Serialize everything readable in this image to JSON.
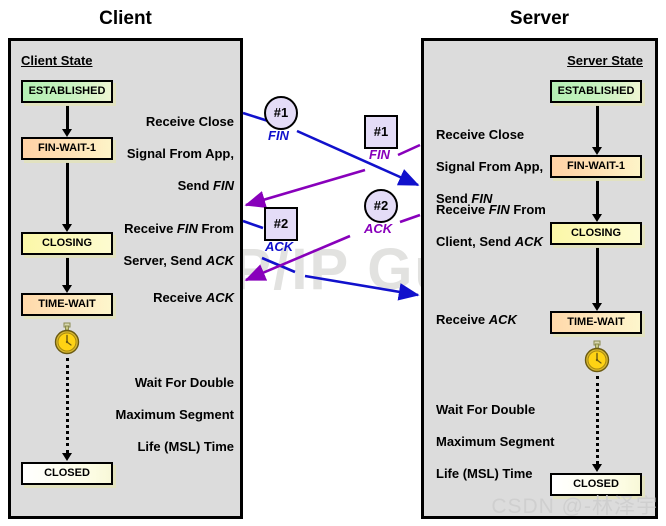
{
  "diagram": {
    "title_client": "Client",
    "title_server": "Server",
    "watermark_guide": "The TCP/IP Guide",
    "watermark_csdn": "CSDN @-林泽宇",
    "colors": {
      "panel_fill": "#dcdcdc",
      "established": "#b4f0b4",
      "fin_wait": "#ffd2a6",
      "closing": "#fbf7a8",
      "time_wait": "#ffd9ab",
      "closed": "#ffffff",
      "blue_arrow": "#1111cc",
      "purple_arrow": "#8800bb",
      "marker_fill": "#e4dcf7"
    }
  },
  "client": {
    "heading": "Client State",
    "states": [
      {
        "label": "ESTABLISHED"
      },
      {
        "label": "FIN-WAIT-1"
      },
      {
        "label": "CLOSING"
      },
      {
        "label": "TIME-WAIT"
      },
      {
        "label": "CLOSED"
      }
    ],
    "actions": [
      {
        "line1": "Receive Close",
        "line2": "Signal From App,",
        "line3_pre": "Send ",
        "line3_em": "FIN"
      },
      {
        "line1_pre": "Receive ",
        "line1_em": "FIN",
        "line1_post": " From",
        "line2_pre": "Server, Send ",
        "line2_em": "ACK"
      },
      {
        "line1_pre": "Receive ",
        "line1_em": "ACK"
      },
      {
        "line1": "Wait For Double",
        "line2": "Maximum Segment",
        "line3": "Life (MSL) Time"
      }
    ],
    "timer_icon": "stopwatch-icon"
  },
  "server": {
    "heading": "Server State",
    "states": [
      {
        "label": "ESTABLISHED"
      },
      {
        "label": "FIN-WAIT-1"
      },
      {
        "label": "CLOSING"
      },
      {
        "label": "TIME-WAIT"
      },
      {
        "label": "CLOSED"
      }
    ],
    "actions": [
      {
        "line1": "Receive Close",
        "line2": "Signal From App,",
        "line3_pre": "Send ",
        "line3_em": "FIN"
      },
      {
        "line1_pre": "Receive ",
        "line1_em": "FIN",
        "line1_post": " From",
        "line2_pre": "Client, Send ",
        "line2_em": "ACK"
      },
      {
        "line1_pre": "Receive ",
        "line1_em": "ACK"
      },
      {
        "line1": "Wait For Double",
        "line2": "Maximum Segment",
        "line3": "Life (MSL) Time"
      }
    ],
    "timer_icon": "stopwatch-icon"
  },
  "messages": [
    {
      "marker": "#1",
      "label": "FIN",
      "direction": "client-to-server",
      "shape": "circle",
      "color": "#1111cc"
    },
    {
      "marker": "#1",
      "label": "FIN",
      "direction": "server-to-client",
      "shape": "square",
      "color": "#8800bb"
    },
    {
      "marker": "#2",
      "label": "ACK",
      "direction": "client-to-server",
      "shape": "square",
      "color": "#1111cc"
    },
    {
      "marker": "#2",
      "label": "ACK",
      "direction": "server-to-client",
      "shape": "circle",
      "color": "#8800bb"
    }
  ]
}
